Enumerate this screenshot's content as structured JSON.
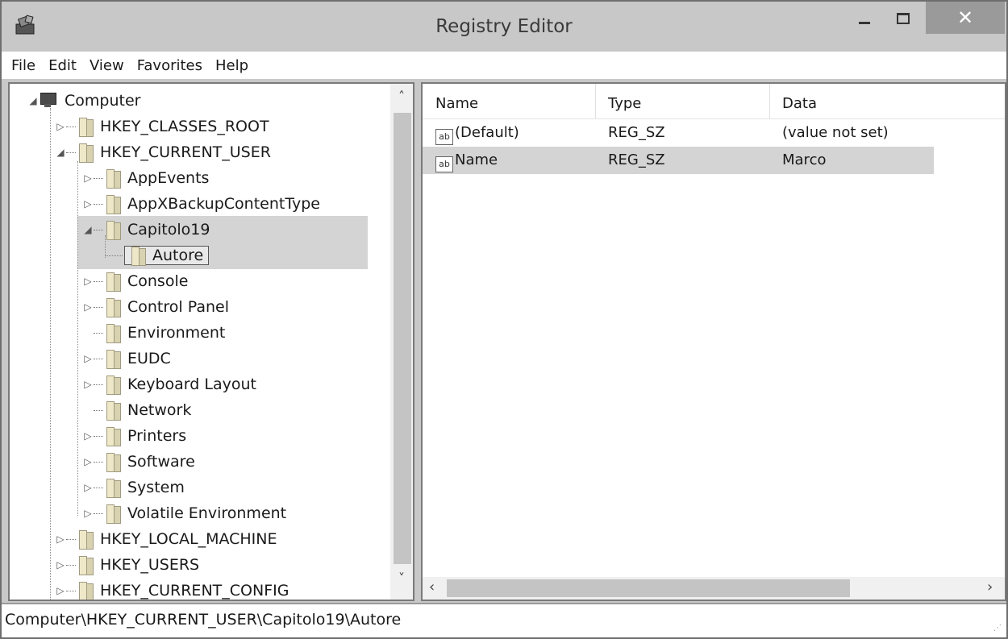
{
  "window": {
    "title": "Registry Editor",
    "minimize_icon": "minimize-icon",
    "maximize_icon": "maximize-icon",
    "close_glyph": "✕"
  },
  "menu": [
    "File",
    "Edit",
    "View",
    "Favorites",
    "Help"
  ],
  "tree": {
    "root": "Computer",
    "items": [
      {
        "label": "HKEY_CLASSES_ROOT",
        "level": 1,
        "state": "collapsed"
      },
      {
        "label": "HKEY_CURRENT_USER",
        "level": 1,
        "state": "expanded"
      },
      {
        "label": "AppEvents",
        "level": 2,
        "state": "collapsed"
      },
      {
        "label": "AppXBackupContentType",
        "level": 2,
        "state": "collapsed"
      },
      {
        "label": "Capitolo19",
        "level": 2,
        "state": "expanded"
      },
      {
        "label": "Autore",
        "level": 3,
        "state": "leaf",
        "selected": true
      },
      {
        "label": "Console",
        "level": 2,
        "state": "collapsed"
      },
      {
        "label": "Control Panel",
        "level": 2,
        "state": "collapsed"
      },
      {
        "label": "Environment",
        "level": 2,
        "state": "leaf"
      },
      {
        "label": "EUDC",
        "level": 2,
        "state": "collapsed"
      },
      {
        "label": "Keyboard Layout",
        "level": 2,
        "state": "collapsed"
      },
      {
        "label": "Network",
        "level": 2,
        "state": "leaf"
      },
      {
        "label": "Printers",
        "level": 2,
        "state": "collapsed"
      },
      {
        "label": "Software",
        "level": 2,
        "state": "collapsed"
      },
      {
        "label": "System",
        "level": 2,
        "state": "collapsed"
      },
      {
        "label": "Volatile Environment",
        "level": 2,
        "state": "collapsed"
      },
      {
        "label": "HKEY_LOCAL_MACHINE",
        "level": 1,
        "state": "collapsed"
      },
      {
        "label": "HKEY_USERS",
        "level": 1,
        "state": "collapsed"
      },
      {
        "label": "HKEY_CURRENT_CONFIG",
        "level": 1,
        "state": "collapsed"
      }
    ]
  },
  "list": {
    "columns": [
      "Name",
      "Type",
      "Data"
    ],
    "icon_text": "ab",
    "rows": [
      {
        "name": "(Default)",
        "type": "REG_SZ",
        "data": "(value not set)",
        "selected": false
      },
      {
        "name": "Name",
        "type": "REG_SZ",
        "data": "Marco",
        "selected": true
      }
    ]
  },
  "status": {
    "path": "Computer\\HKEY_CURRENT_USER\\Capitolo19\\Autore"
  },
  "colors": {
    "titlebar": "#c8c8c8",
    "selection": "#d4d4d4",
    "close_button": "#9a9a9a"
  }
}
